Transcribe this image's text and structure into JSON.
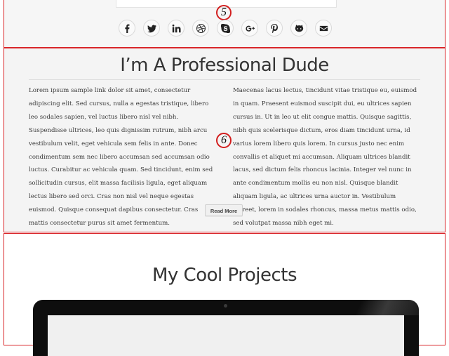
{
  "markers": {
    "social": "5",
    "about": "6"
  },
  "social_links": [
    {
      "icon": "facebook-icon"
    },
    {
      "icon": "twitter-icon"
    },
    {
      "icon": "linkedin-icon"
    },
    {
      "icon": "dribbble-icon"
    },
    {
      "icon": "skype-icon"
    },
    {
      "icon": "google-plus-icon"
    },
    {
      "icon": "pinterest-icon"
    },
    {
      "icon": "github-icon"
    },
    {
      "icon": "email-icon"
    }
  ],
  "about": {
    "title": "I’m A Professional Dude",
    "col_left": "Lorem ipsum sample link dolor sit amet, consectetur adipiscing elit. Sed cursus, nulla a egestas tristique, libero leo sodales sapien, vel luctus libero nisl vel nibh. Suspendisse ultrices, leo quis dignissim rutrum, nibh arcu vestibulum velit, eget vehicula sem felis in ante. Donec condimentum sem nec libero accumsan sed accumsan odio luctus. Curabitur ac vehicula quam. Sed tincidunt, enim sed sollicitudin cursus, elit massa facilisis ligula, eget aliquam lectus libero sed orci. Cras non nisl vel neque egestas euismod. Quisque consequat dapibus consectetur. Cras mattis consectetur purus sit amet fermentum.",
    "col_right": "Maecenas lacus lectus, tincidunt vitae tristique eu, euismod in quam. Praesent euismod suscipit dui, eu ultrices sapien cursus in. Ut in leo ut elit congue mattis. Quisque sagittis, nibh quis scelerisque dictum, eros diam tincidunt urna, id varius lorem libero quis lorem. In cursus justo nec enim convallis et aliquet mi accumsan. Aliquam ultrices blandit lacus, sed dictum felis rhoncus lacinia. Integer vel nunc in ante condimentum mollis eu non nisl. Quisque blandit aliquam ligula, ac ultrices urna auctor in. Vestibulum laoreet, lorem in sodales rhoncus, massa metus mattis odio, sed volutpat massa nibh eget mi.",
    "read_more": "Read More"
  },
  "projects": {
    "title": "My Cool Projects"
  },
  "colors": {
    "marker": "#d21f1f",
    "section_outline": "#d9262a",
    "heading": "#333333"
  }
}
